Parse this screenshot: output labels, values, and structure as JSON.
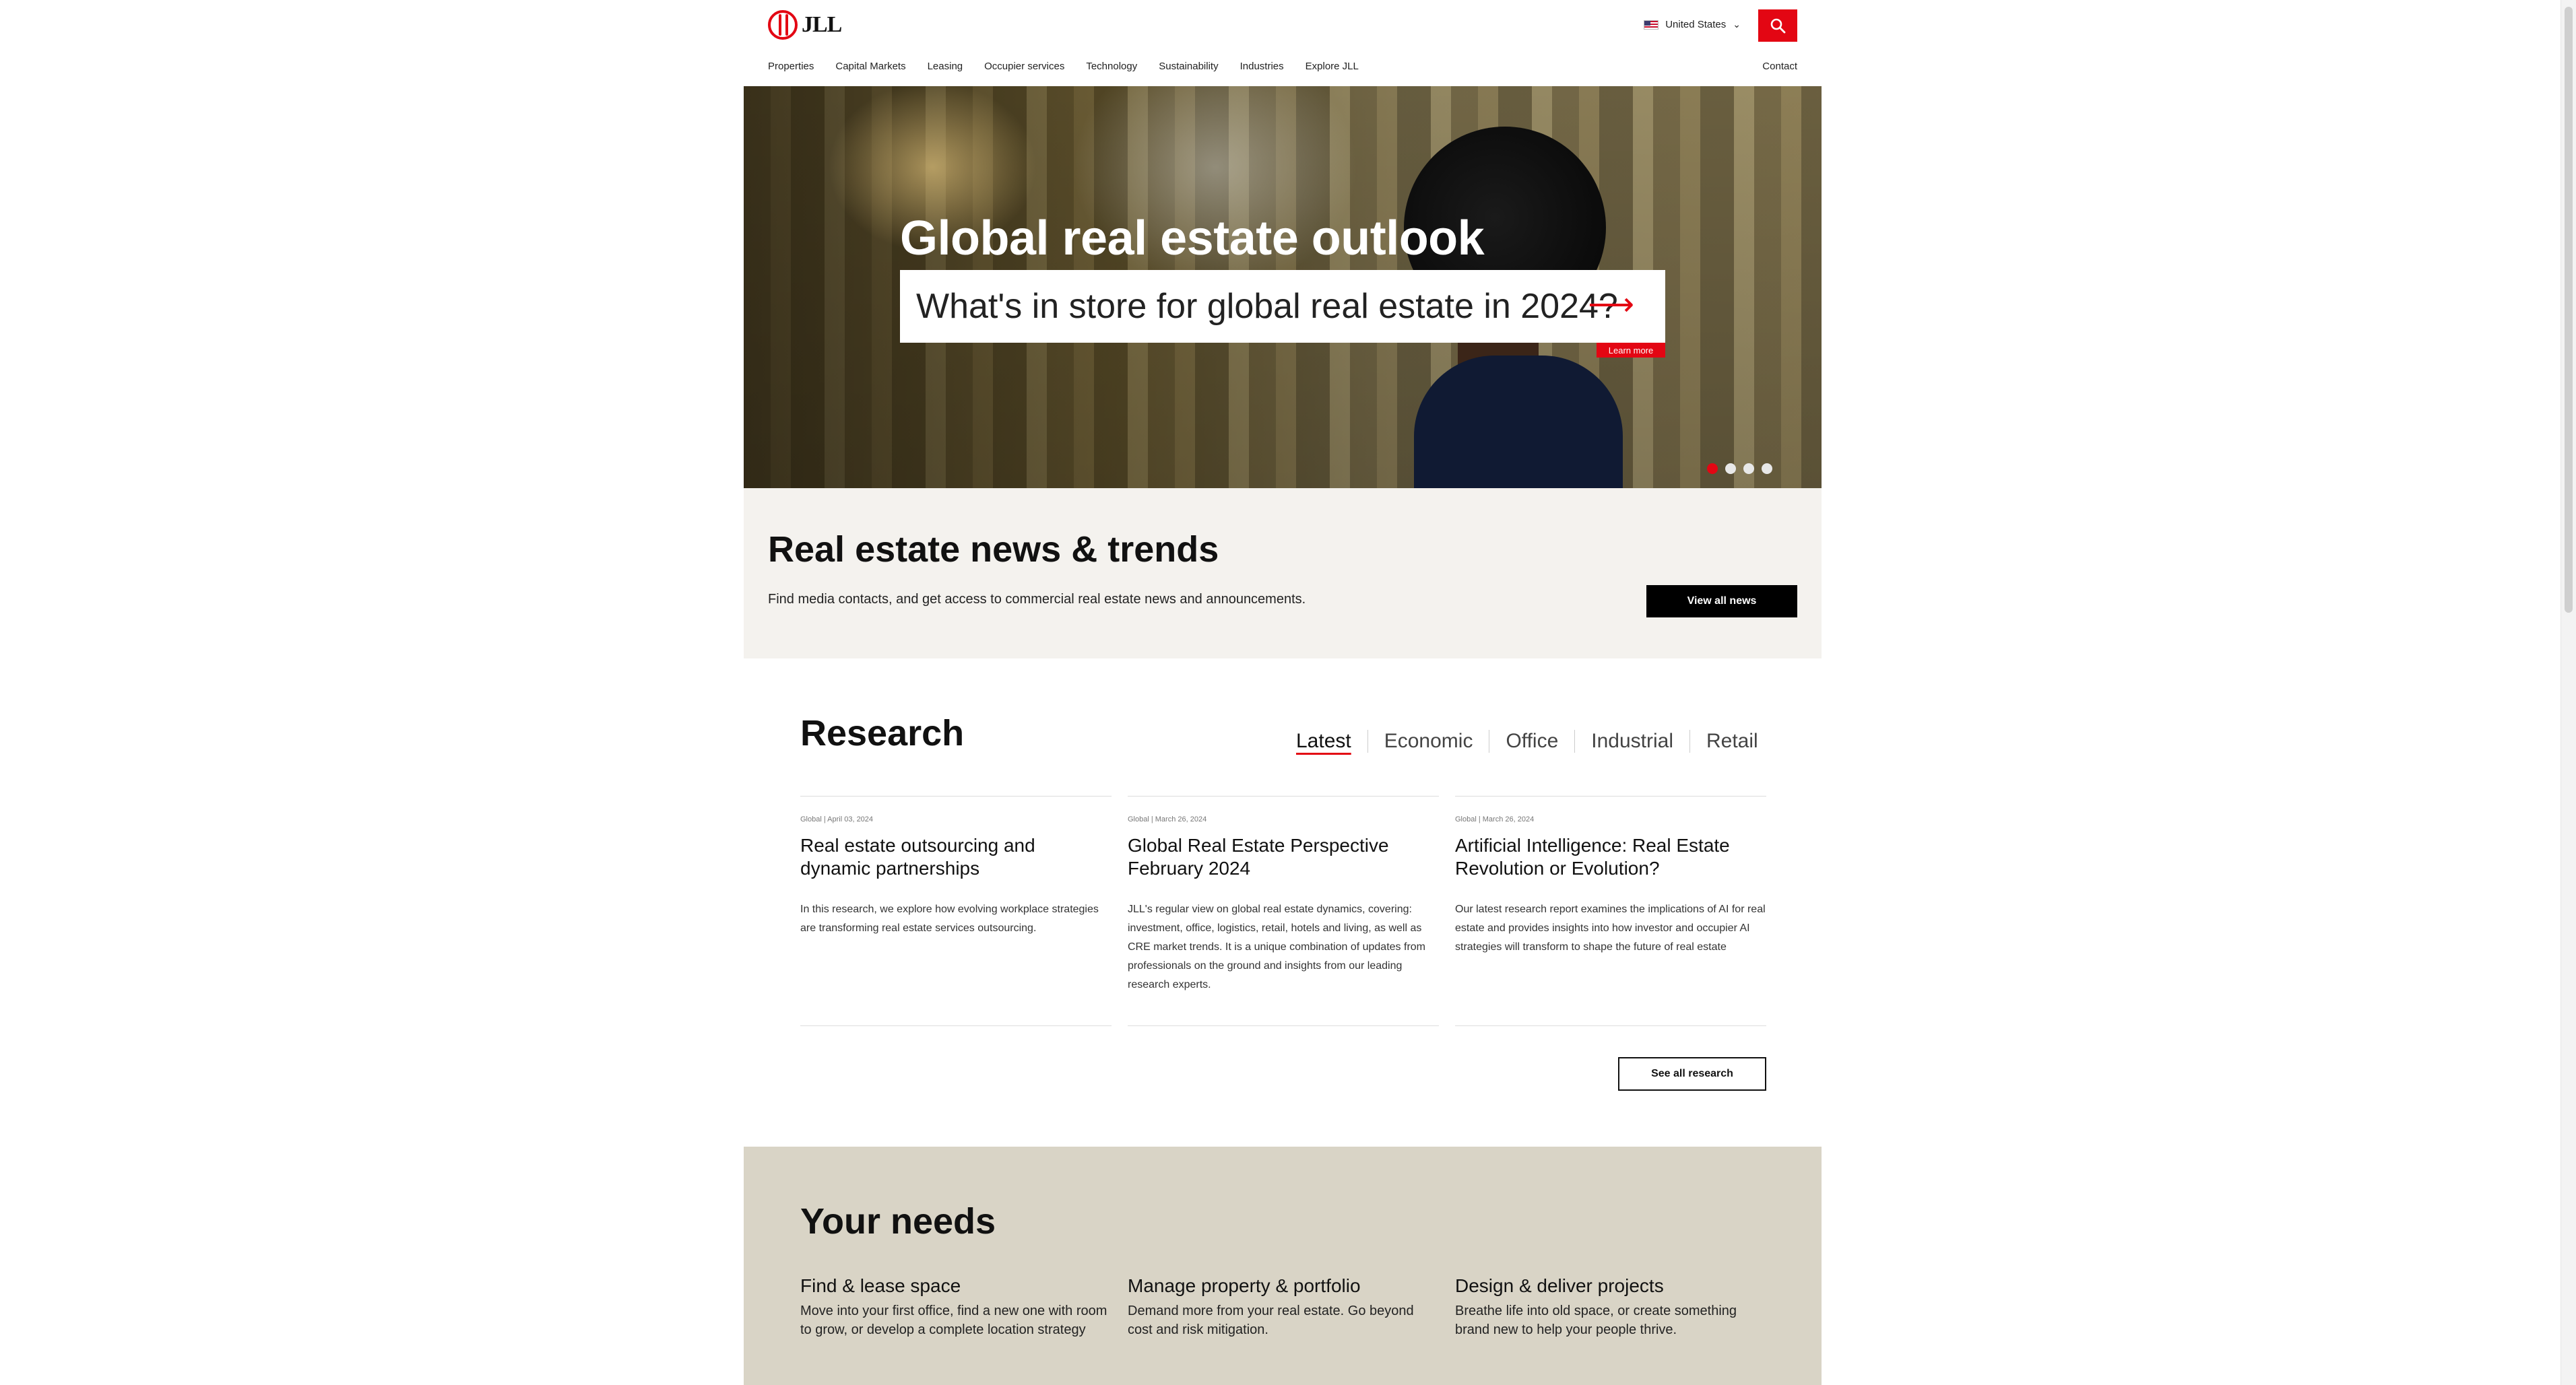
{
  "header": {
    "logo_text": "JLL",
    "country": "United States",
    "nav": [
      "Properties",
      "Capital Markets",
      "Leasing",
      "Occupier services",
      "Technology",
      "Sustainability",
      "Industries",
      "Explore JLL"
    ],
    "contact": "Contact"
  },
  "hero": {
    "title": "Global real estate outlook",
    "subtitle": "What's in store for global real estate in 2024?",
    "learn_more": "Learn more",
    "active_slide": 1,
    "slide_count": 4
  },
  "news": {
    "title": "Real estate news & trends",
    "description": "Find media contacts, and get access to commercial real estate news and announcements.",
    "button": "View all news"
  },
  "research": {
    "title": "Research",
    "tabs": [
      "Latest",
      "Economic",
      "Office",
      "Industrial",
      "Retail"
    ],
    "active_tab": "Latest",
    "cards": [
      {
        "meta": "Global  |  April 03, 2024",
        "title": "Real estate outsourcing and dynamic partnerships",
        "desc": "In this research, we explore how evolving workplace strategies are transforming real estate services outsourcing."
      },
      {
        "meta": "Global  |  March 26, 2024",
        "title": "Global Real Estate Perspective February 2024",
        "desc": "JLL's regular view on global real estate dynamics, covering: investment, office, logistics, retail, hotels and living, as well as CRE market trends. It is a unique combination of updates from professionals on the ground and insights from our leading research experts."
      },
      {
        "meta": "Global  |  March 26, 2024",
        "title": "Artificial Intelligence: Real Estate Revolution or Evolution?",
        "desc": "Our latest research report examines the implications of AI for real estate and provides insights into how investor and occupier AI strategies will transform to shape the future of real estate"
      }
    ],
    "button": "See all research"
  },
  "needs": {
    "title": "Your needs",
    "items": [
      {
        "title": "Find & lease space",
        "desc": "Move into your first office, find a new one with room to grow, or develop a complete location strategy"
      },
      {
        "title": "Manage property & portfolio",
        "desc": "Demand more from your real estate. Go beyond cost and risk mitigation."
      },
      {
        "title": "Design & deliver projects",
        "desc": "Breathe life into old space, or create something brand new to help your people thrive."
      }
    ]
  },
  "colors": {
    "brand_red": "#e30613",
    "news_bg": "#f4f2ee",
    "needs_bg": "#d9d4c6"
  },
  "icons": {
    "search": "search-icon",
    "country_flag": "us-flag-icon",
    "dropdown": "chevron-down-icon",
    "arrow": "arrow-right-icon"
  }
}
